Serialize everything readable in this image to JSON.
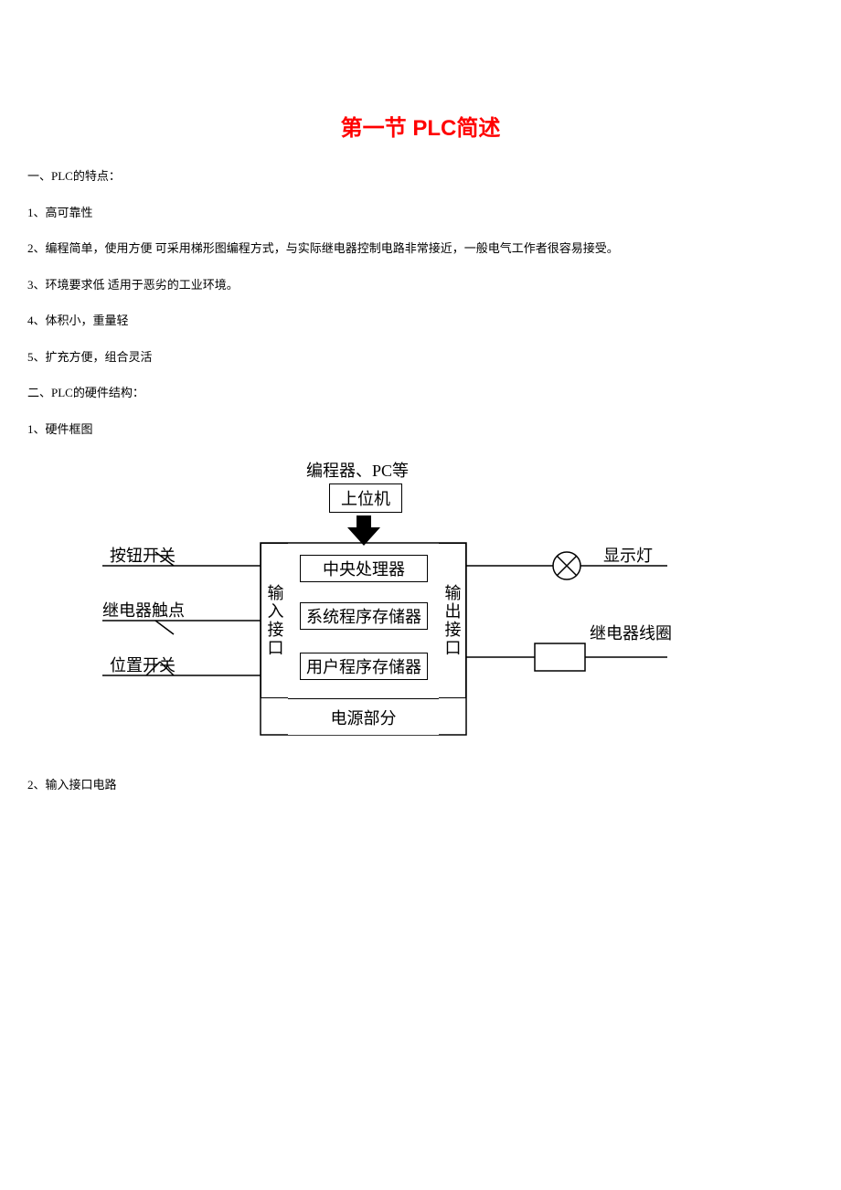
{
  "title": "第一节  PLC简述",
  "section1": {
    "heading": "一、PLC的特点：",
    "items": [
      "1、高可靠性",
      "2、编程简单，使用方便 可采用梯形图编程方式，与实际继电器控制电路非常接近，一般电气工作者很容易接受。",
      "3、环境要求低 适用于恶劣的工业环境。",
      "4、体积小，重量轻",
      "5、扩充方便，组合灵活"
    ]
  },
  "section2": {
    "heading": "二、PLC的硬件结构：",
    "item1": "1、硬件框图",
    "item2": "2、输入接口电路"
  },
  "diagram": {
    "top_label": "编程器、PC等",
    "top_box": "上位机",
    "left_inputs": [
      "按钮开关",
      "继电器触点",
      "位置开关"
    ],
    "left_port": "输入接口",
    "center_boxes": [
      "中央处理器",
      "系统程序存储器",
      "用户程序存储器"
    ],
    "bottom_box": "电源部分",
    "right_port": "输出接口",
    "right_outputs": [
      "显示灯",
      "继电器线圈"
    ]
  }
}
